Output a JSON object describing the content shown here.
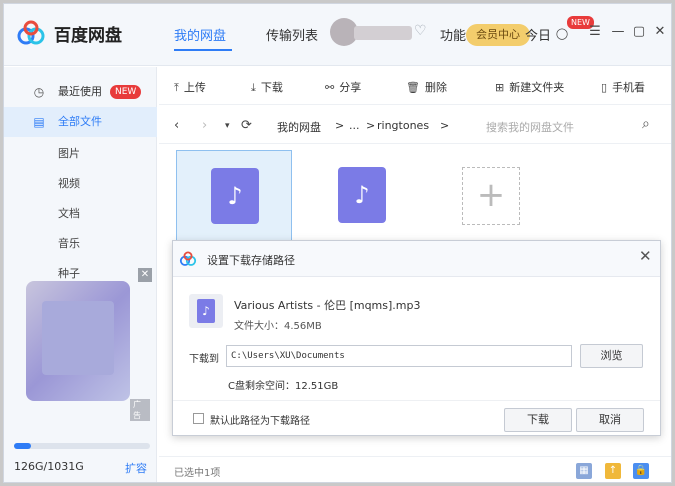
{
  "header": {
    "app_title": "百度网盘",
    "tabs": [
      {
        "label": "我的网盘",
        "active": true
      },
      {
        "label": "传输列表",
        "active": false
      },
      {
        "label": "功能",
        "active": false
      },
      {
        "label": "今日",
        "active": false
      }
    ],
    "vip_label": "会员中心",
    "new_badge": "NEW",
    "accent_color": "#2e7cf6"
  },
  "sidebar": {
    "items": [
      {
        "label": "最近使用",
        "icon": "clock-icon",
        "badge": "NEW"
      },
      {
        "label": "全部文件",
        "icon": "document-icon",
        "active": true
      }
    ],
    "sub_items": [
      "图片",
      "视频",
      "文档",
      "音乐",
      "种子"
    ],
    "ad_tag": "广告",
    "quota": {
      "text": "126G/1031G",
      "used_fraction": 0.122,
      "expand_label": "扩容"
    }
  },
  "toolbar": {
    "upload": "上传",
    "download": "下载",
    "share": "分享",
    "delete": "删除",
    "new_folder": "新建文件夹",
    "phone": "手机看"
  },
  "path": {
    "crumbs": [
      "我的网盘",
      ">",
      "...",
      ">",
      "ringtones",
      ">"
    ],
    "search_placeholder": "搜索我的网盘文件"
  },
  "status": {
    "selected_text": "已选中1项"
  },
  "dialog": {
    "title": "设置下载存储路径",
    "file_name": "Various Artists - 伦巴 [mqms].mp3",
    "file_size": "文件大小：4.56MB",
    "download_to_label": "下载到",
    "path_value": "C:\\Users\\XU\\Documents",
    "browse_label": "浏览",
    "free_space": "C盘剩余空间：12.51GB",
    "default_path_label": "默认此路径为下载路径",
    "download_button": "下载",
    "cancel_button": "取消"
  }
}
